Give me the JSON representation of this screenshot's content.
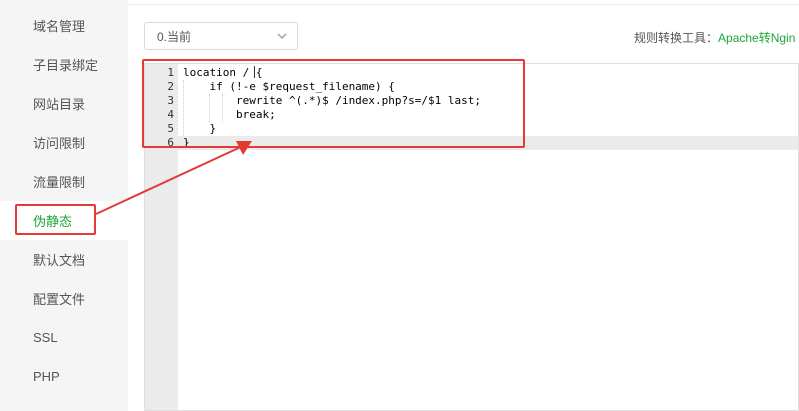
{
  "sidebar": {
    "items": [
      {
        "label": "域名管理",
        "active": false
      },
      {
        "label": "子目录绑定",
        "active": false
      },
      {
        "label": "网站目录",
        "active": false
      },
      {
        "label": "访问限制",
        "active": false
      },
      {
        "label": "流量限制",
        "active": false
      },
      {
        "label": "伪静态",
        "active": true
      },
      {
        "label": "默认文档",
        "active": false
      },
      {
        "label": "配置文件",
        "active": false
      },
      {
        "label": "SSL",
        "active": false
      },
      {
        "label": "PHP",
        "active": false
      }
    ]
  },
  "toolbar": {
    "select_value": "0.当前",
    "tool_label": "规则转换工具：",
    "tool_link": "Apache转Ngin"
  },
  "editor": {
    "line_numbers": [
      "1",
      "2",
      "3",
      "4",
      "5",
      "6"
    ],
    "lines": [
      "location / {",
      "    if (!-e $request_filename) {",
      "        rewrite ^(.*)$ /index.php?s=/$1 last;",
      "        break;",
      "    }",
      "}"
    ],
    "active_line": 6
  },
  "colors": {
    "accent": "#20a53a",
    "annotation": "#e53935",
    "sidebar_bg": "#f5f5f5",
    "gutter_bg": "#ebebeb"
  }
}
